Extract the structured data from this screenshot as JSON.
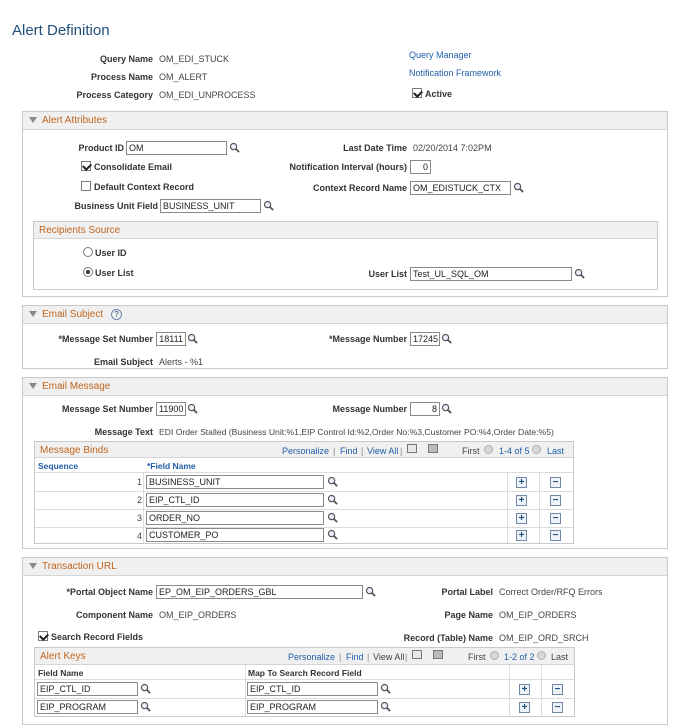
{
  "page_title": "Alert Definition",
  "header": {
    "query_name_label": "Query Name",
    "query_name": "OM_EDI_STUCK",
    "process_name_label": "Process Name",
    "process_name": "OM_ALERT",
    "process_category_label": "Process Category",
    "process_category": "OM_EDI_UNPROCESS",
    "links": [
      "Query Manager",
      "Notification Framework"
    ],
    "active_label": "Active",
    "active": true
  },
  "alert_attributes": {
    "title": "Alert Attributes",
    "product_id_label": "Product ID",
    "product_id": "OM",
    "last_date_time_label": "Last Date Time",
    "last_date_time": "02/20/2014  7:02PM",
    "consolidate_email_label": "Consolidate Email",
    "consolidate_email": true,
    "notification_interval_label": "Notification Interval (hours)",
    "notification_interval": "0",
    "default_context_label": "Default Context Record",
    "default_context": false,
    "context_record_label": "Context Record Name",
    "context_record": "OM_EDISTUCK_CTX",
    "bu_field_label": "Business Unit Field",
    "bu_field": "BUSINESS_UNIT",
    "recipients": {
      "title": "Recipients Source",
      "user_id_label": "User ID",
      "user_list_label": "User List",
      "selected": "User List",
      "user_list_field_label": "User List",
      "user_list_value": "Test_UL_SQL_OM"
    }
  },
  "email_subject": {
    "title": "Email Subject",
    "help_glyph": "?",
    "msg_set_label": "*Message Set Number",
    "msg_set": "18111",
    "msg_num_label": "*Message Number",
    "msg_num": "17245",
    "subject_label": "Email Subject",
    "subject": "Alerts - %1"
  },
  "email_message": {
    "title": "Email Message",
    "msg_set_label": "Message Set Number",
    "msg_set": "11900",
    "msg_num_label": "Message Number",
    "msg_num": "8",
    "msg_text_label": "Message Text",
    "msg_text": "EDI Order Stalled (Business Unit:%1,EIP Control Id:%2,Order No:%3,Customer PO:%4,Order Date:%5)",
    "binds": {
      "title": "Message Binds",
      "toolbar": [
        "Personalize",
        "Find",
        "View All"
      ],
      "first": "First",
      "range": "1-4 of 5",
      "last": "Last",
      "col_sequence": "Sequence",
      "col_field": "*Field Name",
      "rows": [
        {
          "seq": "1",
          "field": "BUSINESS_UNIT"
        },
        {
          "seq": "2",
          "field": "EIP_CTL_ID"
        },
        {
          "seq": "3",
          "field": "ORDER_NO"
        },
        {
          "seq": "4",
          "field": "CUSTOMER_PO"
        }
      ]
    }
  },
  "transaction_url": {
    "title": "Transaction URL",
    "portal_object_label": "*Portal Object Name",
    "portal_object": "EP_OM_EIP_ORDERS_GBL",
    "portal_label_label": "Portal Label",
    "portal_label": "Correct Order/RFQ Errors",
    "component_label": "Component Name",
    "component": "OM_EIP_ORDERS",
    "page_name_label": "Page Name",
    "page_name": "OM_EIP_ORDERS",
    "search_fields_label": "Search Record Fields",
    "search_fields": true,
    "record_table_label": "Record (Table) Name",
    "record_table": "OM_EIP_ORD_SRCH",
    "alert_keys": {
      "title": "Alert Keys",
      "toolbar": [
        "Personalize",
        "Find",
        "View All"
      ],
      "first": "First",
      "range": "1-2 of 2",
      "last": "Last",
      "col_field": "Field Name",
      "col_map": "Map To Search Record Field",
      "rows": [
        {
          "field": "EIP_CTL_ID",
          "map": "EIP_CTL_ID"
        },
        {
          "field": "EIP_PROGRAM",
          "map": "EIP_PROGRAM"
        }
      ]
    }
  },
  "glyphs": {
    "plus": "+",
    "minus": "−",
    "sep": "|"
  },
  "icon_names": [
    "search-icon",
    "collapse-arrow-icon",
    "help-icon",
    "zoom-icon",
    "download-icon",
    "prev-icon",
    "next-icon",
    "add-row-icon",
    "delete-row-icon"
  ]
}
